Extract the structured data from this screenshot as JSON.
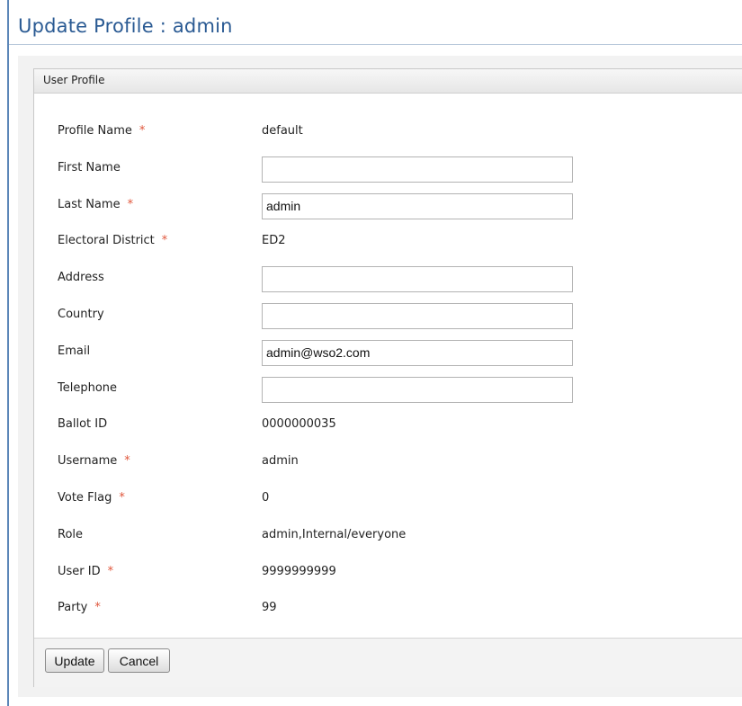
{
  "page": {
    "title": "Update Profile : admin"
  },
  "panel": {
    "header": "User Profile"
  },
  "fields": [
    {
      "label": "Profile Name",
      "required": true,
      "type": "text",
      "value": "default"
    },
    {
      "label": "First Name",
      "required": false,
      "type": "input",
      "value": ""
    },
    {
      "label": "Last Name",
      "required": true,
      "type": "input",
      "value": "admin"
    },
    {
      "label": "Electoral District",
      "required": true,
      "type": "text",
      "value": "ED2"
    },
    {
      "label": "Address",
      "required": false,
      "type": "input",
      "value": ""
    },
    {
      "label": "Country",
      "required": false,
      "type": "input",
      "value": ""
    },
    {
      "label": "Email",
      "required": false,
      "type": "input",
      "value": "admin@wso2.com"
    },
    {
      "label": "Telephone",
      "required": false,
      "type": "input",
      "value": ""
    },
    {
      "label": "Ballot ID",
      "required": false,
      "type": "text",
      "value": "0000000035"
    },
    {
      "label": "Username",
      "required": true,
      "type": "text",
      "value": "admin"
    },
    {
      "label": "Vote Flag",
      "required": true,
      "type": "text",
      "value": "0"
    },
    {
      "label": "Role",
      "required": false,
      "type": "text",
      "value": "admin,Internal/everyone"
    },
    {
      "label": "User ID",
      "required": true,
      "type": "text",
      "value": "9999999999"
    },
    {
      "label": "Party",
      "required": true,
      "type": "text",
      "value": "99"
    }
  ],
  "required_marker": "*",
  "buttons": {
    "update": "Update",
    "cancel": "Cancel"
  },
  "colors": {
    "title": "#2a5a93",
    "required": "#e0563b"
  }
}
